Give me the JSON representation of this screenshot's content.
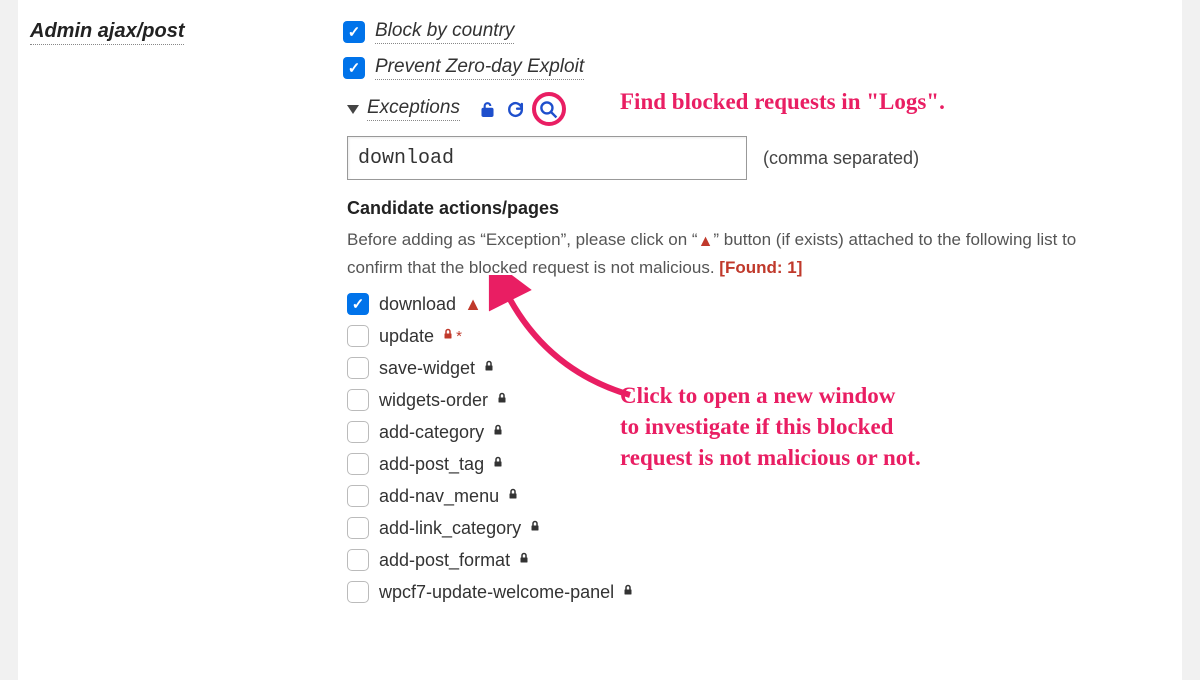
{
  "section_title": "Admin ajax/post",
  "options": {
    "block_country": {
      "label": "Block by country",
      "checked": true
    },
    "prevent_zeroday": {
      "label": "Prevent Zero-day Exploit",
      "checked": true
    }
  },
  "exceptions": {
    "label": "Exceptions",
    "input_value": "download",
    "hint": "(comma separated)"
  },
  "candidates": {
    "title": "Candidate actions/pages",
    "desc_pre": "Before adding as “Exception”, please click on “",
    "desc_post": "” button (if exists) attached to the following list to confirm that the blocked request is not malicious. ",
    "found_label": "[Found: 1]",
    "items": [
      {
        "label": "download",
        "checked": true,
        "badge": "warn"
      },
      {
        "label": "update",
        "checked": false,
        "badge": "lock-red-star"
      },
      {
        "label": "save-widget",
        "checked": false,
        "badge": "lock"
      },
      {
        "label": "widgets-order",
        "checked": false,
        "badge": "lock"
      },
      {
        "label": "add-category",
        "checked": false,
        "badge": "lock"
      },
      {
        "label": "add-post_tag",
        "checked": false,
        "badge": "lock"
      },
      {
        "label": "add-nav_menu",
        "checked": false,
        "badge": "lock"
      },
      {
        "label": "add-link_category",
        "checked": false,
        "badge": "lock"
      },
      {
        "label": "add-post_format",
        "checked": false,
        "badge": "lock"
      },
      {
        "label": "wpcf7-update-welcome-panel",
        "checked": false,
        "badge": "lock"
      }
    ]
  },
  "annotations": {
    "a1": "Find blocked requests in \"Logs\".",
    "a2": "Click to open a new window\nto investigate if this blocked\nrequest is not malicious or not."
  },
  "colors": {
    "accent": "#0073ea",
    "danger": "#c0392b",
    "annotation": "#e91e63"
  }
}
